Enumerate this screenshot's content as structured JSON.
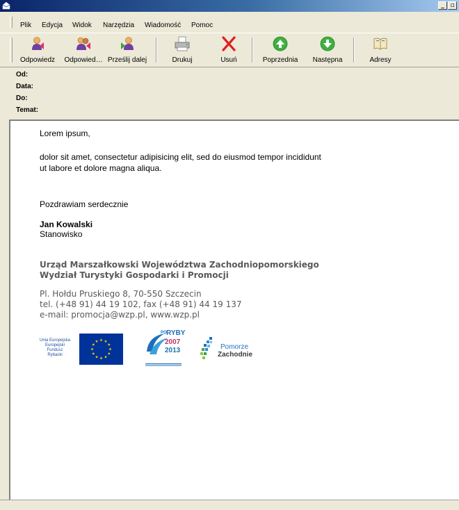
{
  "window": {
    "minimize_glyph": "_",
    "maximize_glyph": "▫"
  },
  "menu": [
    "Plik",
    "Edycja",
    "Widok",
    "Narzędzia",
    "Wiadomość",
    "Pomoc"
  ],
  "toolbar": {
    "reply": "Odpowiedz",
    "reply_all": "Odpowied…",
    "forward": "Prześlij dalej",
    "print": "Drukuj",
    "delete": "Usuń",
    "previous": "Poprzednia",
    "next": "Następna",
    "addresses": "Adresy"
  },
  "headers": {
    "from": "Od:",
    "date": "Data:",
    "to": "Do:",
    "subject": "Temat:"
  },
  "body": {
    "greeting": "Lorem ipsum,",
    "line1": "dolor sit amet, consectetur adipisicing elit, sed do eiusmod tempor incididunt",
    "line2": "ut labore et dolore magna aliqua.",
    "closing": "Pozdrawiam serdecznie",
    "name": "Jan Kowalski",
    "position": "Stanowisko"
  },
  "signature": {
    "org1": "Urząd Marszałkowski Województwa Zachodniopomorskiego",
    "org2": "Wydział Turystyki Gospodarki i Promocji",
    "address": "Pl. Hołdu Pruskiego 8, 70-550 Szczecin",
    "phone": "tel. (+48 91) 44 19 102, fax (+48 91) 44 19 137",
    "email": "e-mail: promocja@wzp.pl, www.wzp.pl"
  },
  "logos": {
    "eu_fund": [
      "Unia Europejska",
      "Europejski",
      "Fundusz",
      "Rybacki"
    ],
    "po_ryby": {
      "po": "PO",
      "ryby": "RYBY",
      "y1": "2007",
      "y2": "2013"
    },
    "pomorze": {
      "line1": "Pomorze",
      "line2": "Zachodnie"
    }
  },
  "colors": {
    "title_start": "#0a246a",
    "title_end": "#a6caf0",
    "chrome": "#ece9d8",
    "eu_blue": "#003399",
    "eu_star": "#ffcc00"
  }
}
